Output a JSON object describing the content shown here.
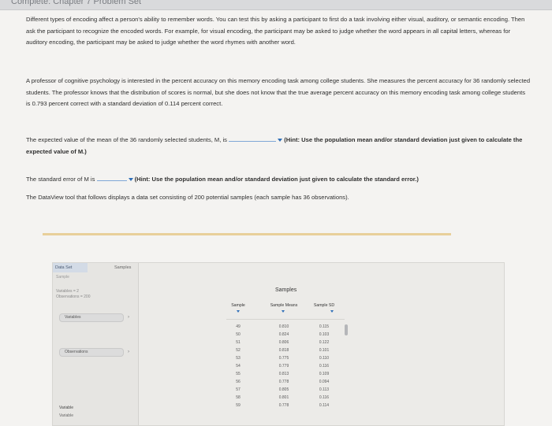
{
  "window": {
    "title": "Complete: Chapter 7 Problem Set"
  },
  "intro": {
    "p1": "Different types of encoding affect a person's ability to remember words. You can test this by asking a participant to first do a task involving either visual, auditory, or semantic encoding. Then ask the participant to recognize the encoded words. For example, for visual encoding, the participant may be asked to judge whether the word appears in all capital letters, whereas for auditory encoding, the participant may be asked to judge whether the word rhymes with another word.",
    "p2": "A professor of cognitive psychology is interested in the percent accuracy on this memory encoding task among college students. She measures the percent accuracy for 36 randomly selected students. The professor knows that the distribution of scores is normal, but she does not know that the true average percent accuracy on this memory encoding task among college students is 0.793 percent correct with a standard deviation of 0.114 percent correct."
  },
  "q1": {
    "text": "The expected value of the mean of the 36 randomly selected students, M, is",
    "hint": "(Hint: Use the population mean and/or standard deviation just given to calculate the expected value of M.)"
  },
  "q2": {
    "text": "The standard error of M is",
    "hint": "(Hint: Use the population mean and/or standard deviation just given to calculate the standard error.)"
  },
  "dataview_intro": "The DataView tool that follows displays a data set consisting of 200 potential samples (each sample has 36 observations).",
  "dataview": {
    "tabs": {
      "dataset": "Data Set",
      "samples": "Samples"
    },
    "sample_label": "Sample",
    "variables_info": "Variables = 2",
    "observations_info": "Observations = 200",
    "variables_btn": "Variables",
    "observations_btn": "Observations",
    "variable_label": "Variable",
    "variable_value": "Variable",
    "title": "Samples",
    "columns": {
      "sample": "Sample",
      "means": "Sample Means",
      "sd": "Sample SD"
    },
    "rows": [
      {
        "sample": "49",
        "mean": "0.810",
        "sd": "0.115"
      },
      {
        "sample": "50",
        "mean": "0.824",
        "sd": "0.103"
      },
      {
        "sample": "51",
        "mean": "0.806",
        "sd": "0.122"
      },
      {
        "sample": "52",
        "mean": "0.818",
        "sd": "0.101"
      },
      {
        "sample": "53",
        "mean": "0.775",
        "sd": "0.110"
      },
      {
        "sample": "54",
        "mean": "0.779",
        "sd": "0.116"
      },
      {
        "sample": "55",
        "mean": "0.813",
        "sd": "0.109"
      },
      {
        "sample": "56",
        "mean": "0.778",
        "sd": "0.094"
      },
      {
        "sample": "57",
        "mean": "0.805",
        "sd": "0.113"
      },
      {
        "sample": "58",
        "mean": "0.801",
        "sd": "0.116"
      },
      {
        "sample": "59",
        "mean": "0.778",
        "sd": "0.114"
      }
    ]
  }
}
